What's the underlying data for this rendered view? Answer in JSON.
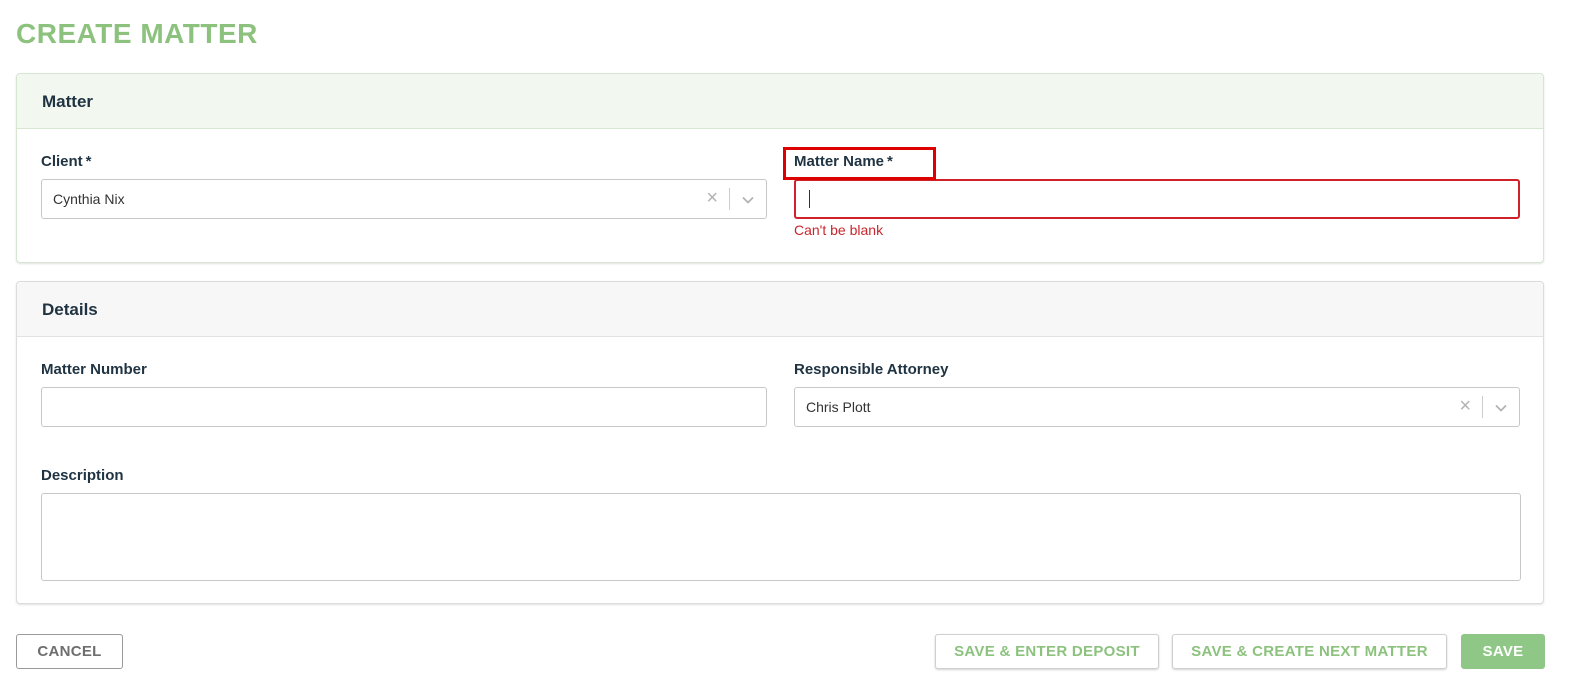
{
  "page": {
    "title": "CREATE MATTER"
  },
  "matter_section": {
    "heading": "Matter",
    "client": {
      "label": "Client",
      "required_mark": "*",
      "value": "Cynthia Nix"
    },
    "matter_name": {
      "label": "Matter Name",
      "required_mark": "*",
      "value": "",
      "error": "Can't be blank"
    }
  },
  "details_section": {
    "heading": "Details",
    "matter_number": {
      "label": "Matter Number",
      "value": ""
    },
    "responsible_attorney": {
      "label": "Responsible Attorney",
      "value": "Chris Plott"
    },
    "description": {
      "label": "Description",
      "value": ""
    }
  },
  "actions": {
    "cancel": "CANCEL",
    "save_enter_deposit": "SAVE & ENTER DEPOSIT",
    "save_create_next": "SAVE & CREATE NEXT MATTER",
    "save": "SAVE"
  },
  "colors": {
    "accent": "#8cc27e",
    "error": "#d0212b",
    "heading_text": "#1f3342"
  }
}
